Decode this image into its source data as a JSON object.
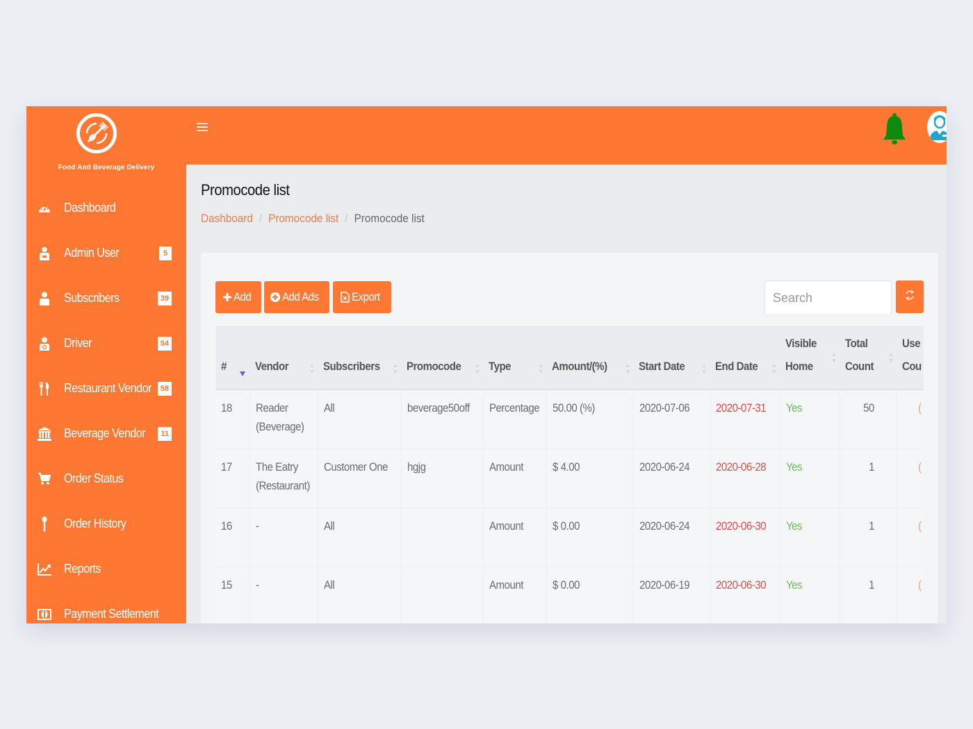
{
  "brand": {
    "name": "Food And Beverage Delivery",
    "logo_icon": "fork-spoon-logo-icon"
  },
  "sidebar": {
    "items": [
      {
        "label": "Dashboard",
        "icon": "dashboard-gauge-icon",
        "badge": null
      },
      {
        "label": "Admin User",
        "icon": "admin-user-icon",
        "badge": "5"
      },
      {
        "label": "Subscribers",
        "icon": "user-icon",
        "badge": "39"
      },
      {
        "label": "Driver",
        "icon": "driver-icon",
        "badge": "54"
      },
      {
        "label": "Restaurant Vendor",
        "icon": "cutlery-icon",
        "badge": "58"
      },
      {
        "label": "Beverage Vendor",
        "icon": "bank-building-icon",
        "badge": "11"
      },
      {
        "label": "Order Status",
        "icon": "cart-icon",
        "badge": null
      },
      {
        "label": "Order History",
        "icon": "spoon-icon",
        "badge": null
      },
      {
        "label": "Reports",
        "icon": "line-chart-icon",
        "badge": null
      },
      {
        "label": "Payment Settlement",
        "icon": "money-icon",
        "badge": null
      }
    ]
  },
  "topbar": {
    "menu_icon": "hamburger-menu-icon",
    "notification_icon": "bell-icon",
    "notification_color": "#0f8a0f",
    "avatar_icon": "user-avatar-icon"
  },
  "page": {
    "title": "Promocode list",
    "breadcrumb": [
      {
        "label": "Dashboard",
        "link": true
      },
      {
        "label": "Promocode list",
        "link": true
      },
      {
        "label": "Promocode list",
        "link": false
      }
    ]
  },
  "toolbar": {
    "add_label": "Add",
    "add_ads_label": "Add Ads",
    "export_label": "Export",
    "search_placeholder": "Search",
    "search_value": "",
    "refresh_icon": "refresh-icon"
  },
  "colors": {
    "accent": "#fe7733",
    "end_date": "#e04a4a",
    "visible_yes": "#6cbd5c"
  },
  "table": {
    "columns": [
      {
        "line1": "",
        "line2": "#"
      },
      {
        "line1": "",
        "line2": "Vendor"
      },
      {
        "line1": "",
        "line2": "Subscribers"
      },
      {
        "line1": "",
        "line2": "Promocode"
      },
      {
        "line1": "",
        "line2": "Type"
      },
      {
        "line1": "",
        "line2": "Amount/(%)"
      },
      {
        "line1": "",
        "line2": "Start Date"
      },
      {
        "line1": "",
        "line2": "End Date"
      },
      {
        "line1": "Visible",
        "line2": "Home"
      },
      {
        "line1": "Total",
        "line2": "Count"
      },
      {
        "line1": "Use",
        "line2": "Cou"
      }
    ],
    "sorted_column": "#",
    "sort_direction": "descending",
    "rows": [
      {
        "id": "18",
        "vendor_1": "Reader",
        "vendor_2": "(Beverage)",
        "subscribers": "All",
        "promocode": "beverage50off",
        "type": "Percentage",
        "amount": "50.00 (%)",
        "start_date": "2020-07-06",
        "end_date": "2020-07-31",
        "visible_home": "Yes",
        "total_count": "50",
        "use_count": "("
      },
      {
        "id": "17",
        "vendor_1": "The Eatry",
        "vendor_2": "(Restaurant)",
        "subscribers": "Customer One",
        "promocode": "hgjg",
        "type": "Amount",
        "amount": "$ 4.00",
        "start_date": "2020-06-24",
        "end_date": "2020-06-28",
        "visible_home": "Yes",
        "total_count": "1",
        "use_count": "("
      },
      {
        "id": "16",
        "vendor_1": "-",
        "vendor_2": "",
        "subscribers": "All",
        "promocode": "",
        "type": "Amount",
        "amount": "$ 0.00",
        "start_date": "2020-06-24",
        "end_date": "2020-06-30",
        "visible_home": "Yes",
        "total_count": "1",
        "use_count": "("
      },
      {
        "id": "15",
        "vendor_1": "-",
        "vendor_2": "",
        "subscribers": "All",
        "promocode": "",
        "type": "Amount",
        "amount": "$ 0.00",
        "start_date": "2020-06-19",
        "end_date": "2020-06-30",
        "visible_home": "Yes",
        "total_count": "1",
        "use_count": "("
      }
    ]
  }
}
